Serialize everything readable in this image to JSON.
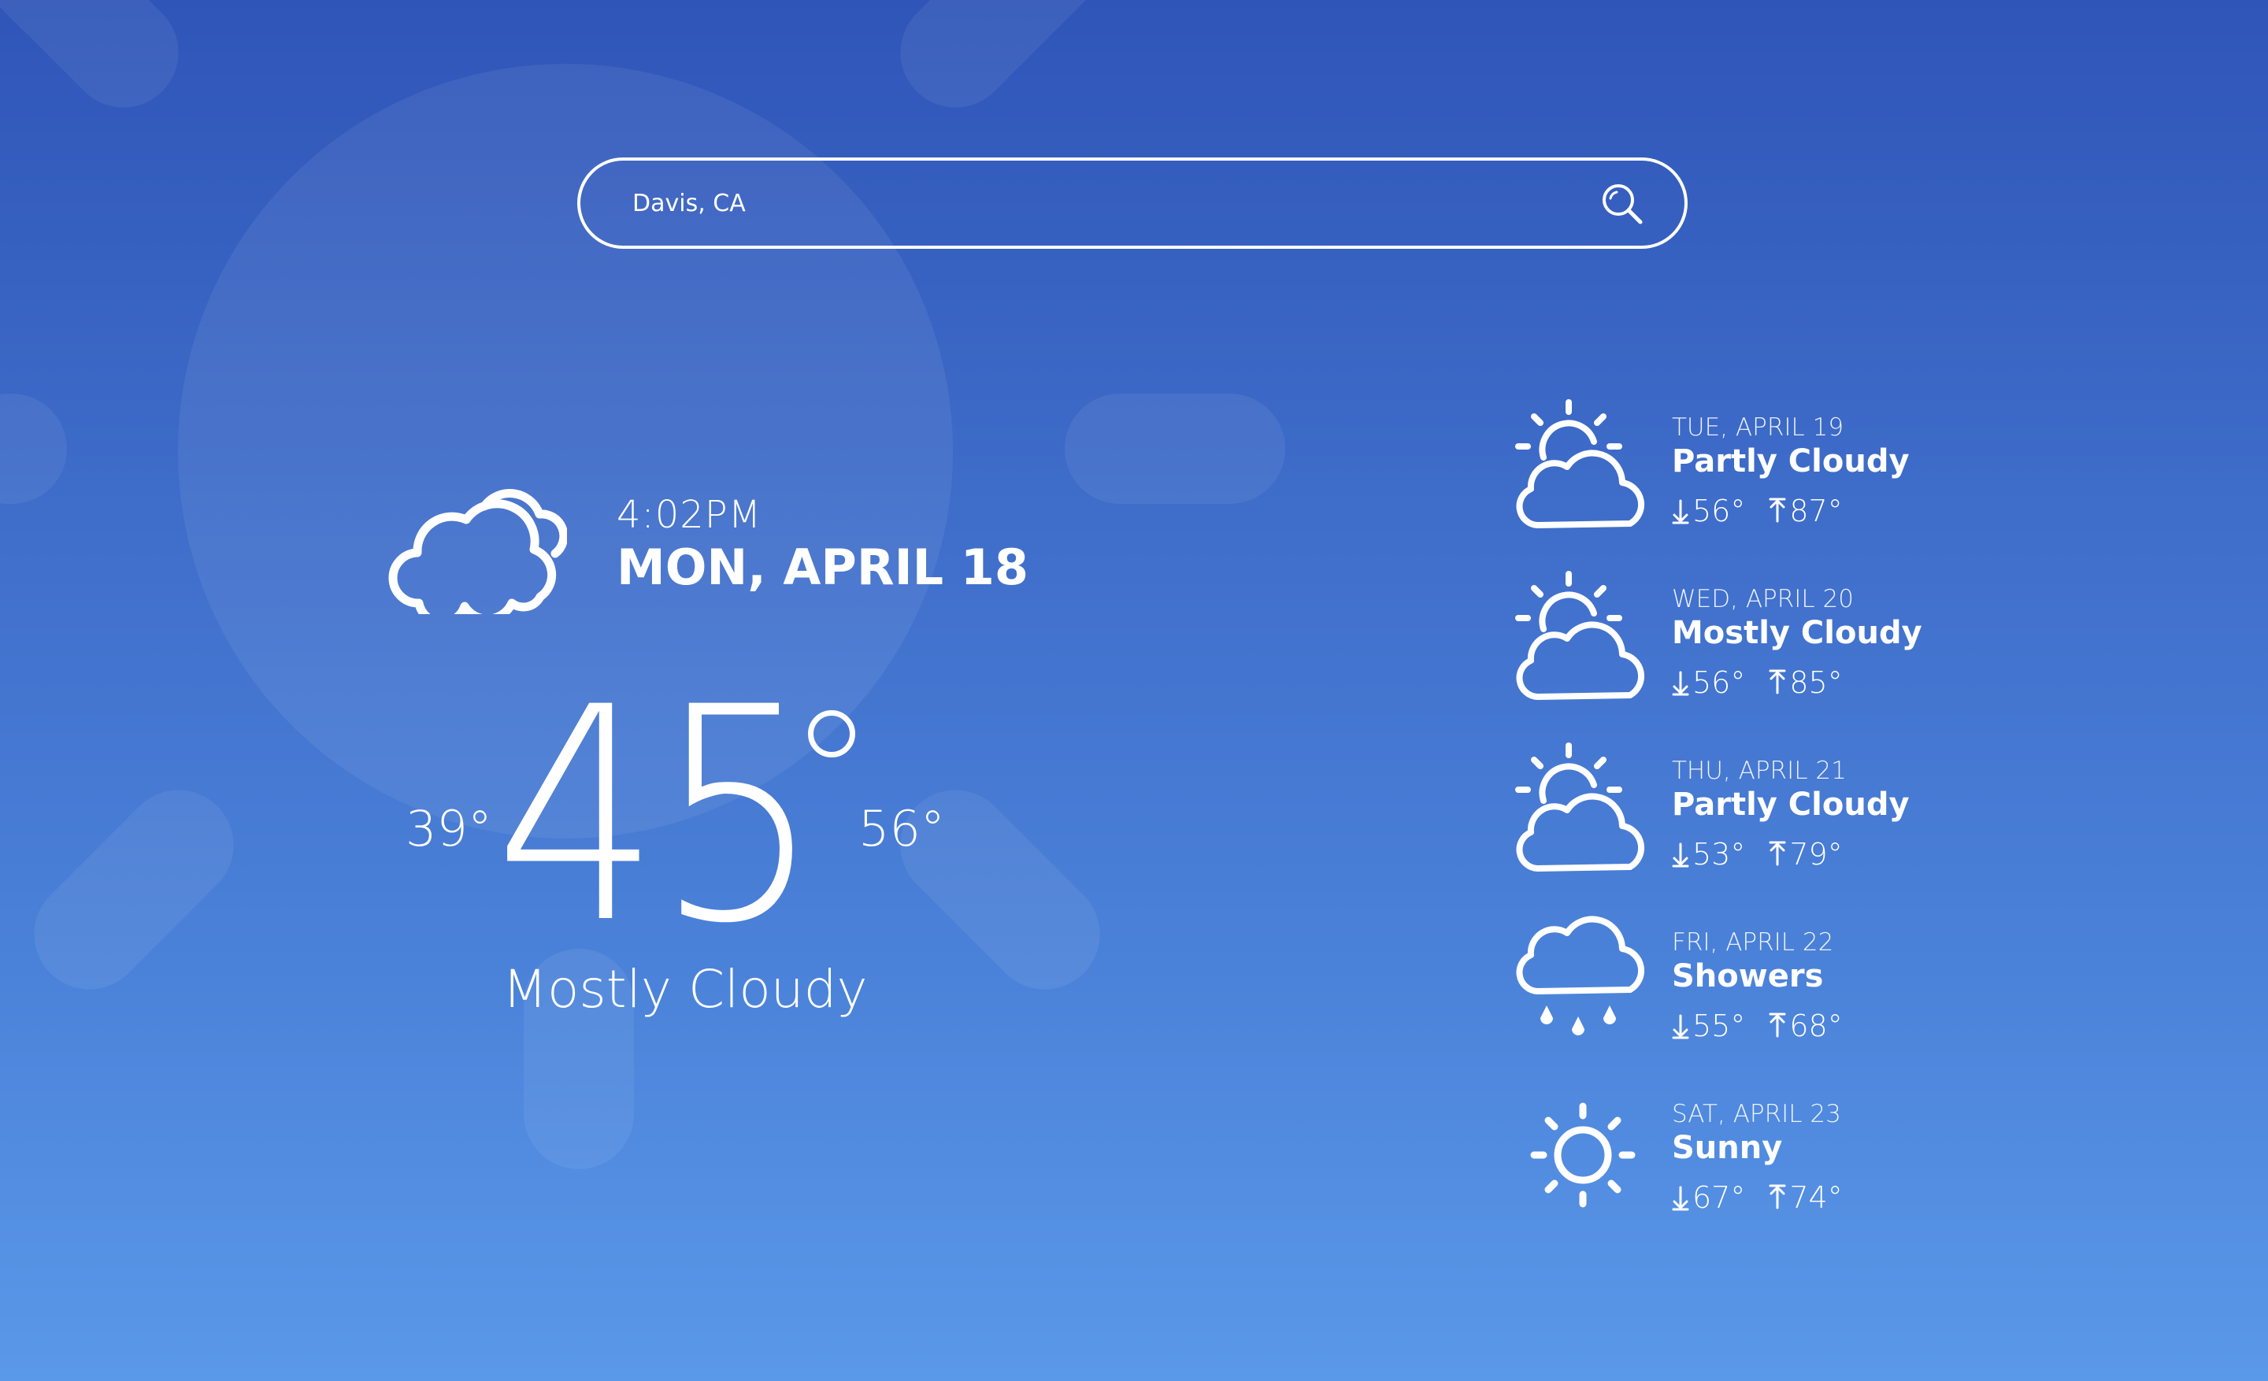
{
  "search": {
    "value": "Davis, CA",
    "icon": "search-icon"
  },
  "current": {
    "icon": "cloudy-icon",
    "time": "4:02PM",
    "date": "MON, APRIL 18",
    "temp": "45",
    "low": "39°",
    "high": "56°",
    "condition": "Mostly Cloudy"
  },
  "forecast": [
    {
      "day": "TUE, APRIL 19",
      "condition": "Partly Cloudy",
      "low": "56°",
      "high": "87°",
      "icon": "partly-cloudy-icon"
    },
    {
      "day": "WED, APRIL 20",
      "condition": "Mostly Cloudy",
      "low": "56°",
      "high": "85°",
      "icon": "partly-cloudy-icon"
    },
    {
      "day": "THU, APRIL 21",
      "condition": "Partly Cloudy",
      "low": "53°",
      "high": "79°",
      "icon": "partly-cloudy-icon"
    },
    {
      "day": "FRI, APRIL 22",
      "condition": "Showers",
      "low": "55°",
      "high": "68°",
      "icon": "showers-icon"
    },
    {
      "day": "SAT, APRIL 23",
      "condition": "Sunny",
      "low": "67°",
      "high": "74°",
      "icon": "sunny-icon"
    }
  ],
  "colors": {
    "background_top": "#2f55b8",
    "background_bottom": "#5a98e9",
    "foreground": "#ffffff"
  }
}
